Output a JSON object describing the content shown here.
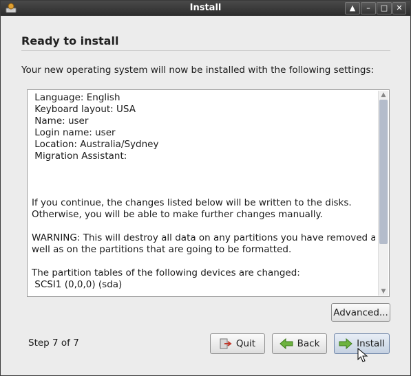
{
  "window": {
    "title": "Install"
  },
  "page": {
    "heading": "Ready to install",
    "intro": "Your new operating system will now be installed with the following settings:"
  },
  "summary_lines": [
    " Language: English",
    " Keyboard layout: USA",
    " Name: user",
    " Login name: user",
    " Location: Australia/Sydney",
    " Migration Assistant:",
    "",
    "",
    "",
    "If you continue, the changes listed below will be written to the disks.",
    "Otherwise, you will be able to make further changes manually.",
    "",
    "WARNING: This will destroy all data on any partitions you have removed as",
    "well as on the partitions that are going to be formatted.",
    "",
    "The partition tables of the following devices are changed:",
    " SCSI1 (0,0,0) (sda)"
  ],
  "buttons": {
    "advanced": "Advanced...",
    "quit": "Quit",
    "back": "Back",
    "install": "Install"
  },
  "footer": {
    "step": "Step 7 of 7"
  }
}
